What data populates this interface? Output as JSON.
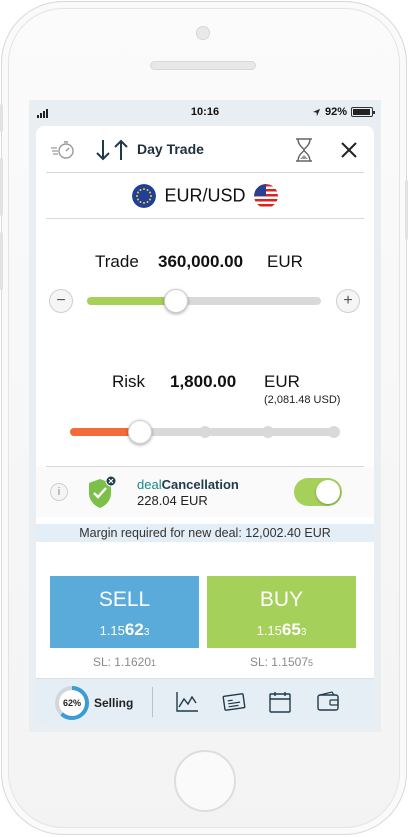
{
  "status": {
    "time": "10:16",
    "battery": "92%"
  },
  "header": {
    "title": "Day Trade"
  },
  "instrument": {
    "pair": "EUR/USD",
    "base_flag": "eu-flag",
    "quote_flag": "us-flag"
  },
  "trade": {
    "label": "Trade",
    "value": "360,000.00",
    "currency": "EUR",
    "slider_level": 0.38
  },
  "risk": {
    "label": "Risk",
    "value": "1,800.00",
    "currency": "EUR",
    "converted": "(2,081.48 USD)",
    "slider_level": 0.26
  },
  "deal_cancellation": {
    "prefix": "deal",
    "suffix": "Cancellation",
    "price": "228.04 EUR",
    "enabled": true
  },
  "margin": {
    "text": "Margin required for new deal: 12,002.40 EUR"
  },
  "sell": {
    "label": "SELL",
    "price_prefix": "1.15",
    "price_big": "62",
    "price_small": "3",
    "sl_prefix": "SL: 1.1620",
    "sl_small": "1",
    "color": "#5aabd9"
  },
  "buy": {
    "label": "BUY",
    "price_prefix": "1.15",
    "price_big": "65",
    "price_small": "3",
    "sl_prefix": "SL: 1.1507",
    "sl_small": "5",
    "color": "#a5d05a"
  },
  "bottom_bar": {
    "sentiment_percent": "62%",
    "sentiment_label": "Selling",
    "sentiment_value": 0.62
  },
  "colors": {
    "green": "#a5d05a",
    "orange": "#f26b3a",
    "blue": "#5aabd9",
    "teal": "#1a8a8a"
  }
}
